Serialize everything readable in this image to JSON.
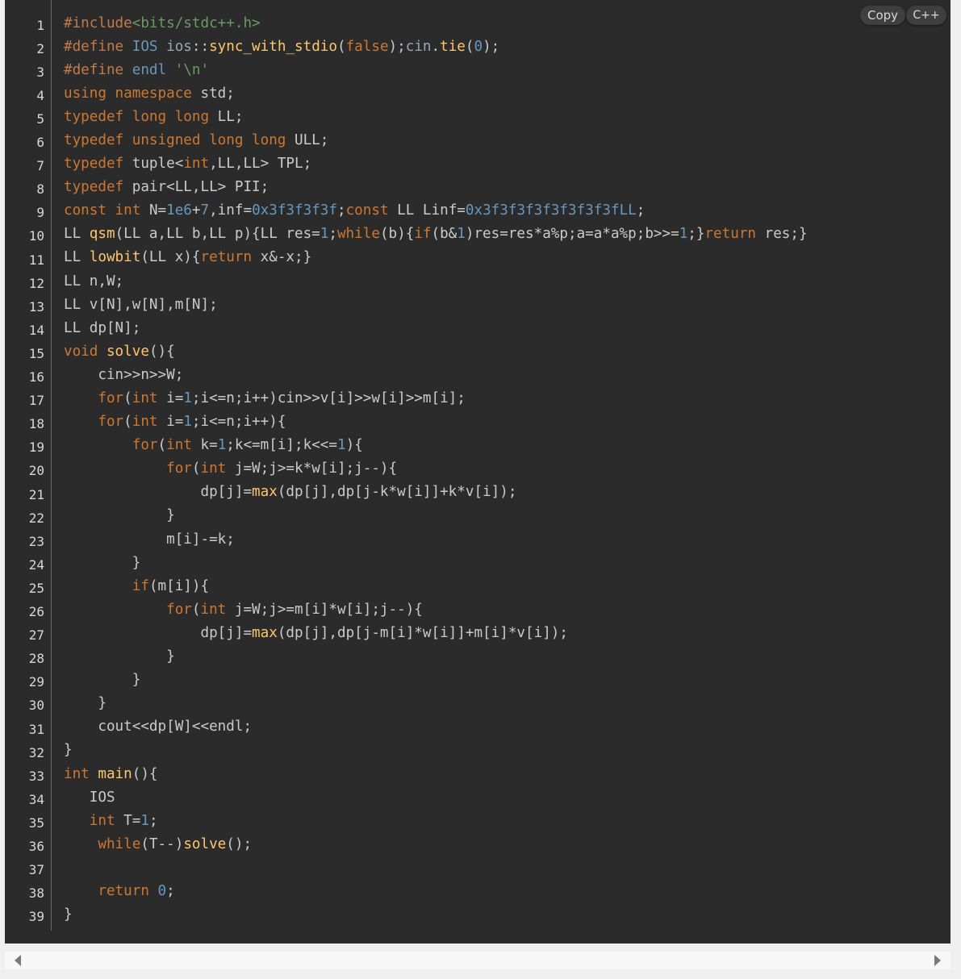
{
  "toolbar": {
    "copy_label": "Copy",
    "language": "C++"
  },
  "colors": {
    "background": "#2b2b2b",
    "preprocessor": "#c27a4b",
    "string": "#6b9a66",
    "keyword": "#cc7832",
    "function": "#ffc66d",
    "number": "#6897bb",
    "plain": "#c9cbcb",
    "line_number": "#d8d8d8"
  },
  "code": {
    "line_numbers": [
      "1",
      "2",
      "3",
      "4",
      "5",
      "6",
      "7",
      "8",
      "9",
      "10",
      "11",
      "12",
      "13",
      "14",
      "15",
      "16",
      "17",
      "18",
      "19",
      "20",
      "21",
      "22",
      "23",
      "24",
      "25",
      "26",
      "27",
      "28",
      "29",
      "30",
      "31",
      "32",
      "33",
      "34",
      "35",
      "36",
      "37",
      "38",
      "39"
    ],
    "lines": [
      [
        [
          "pp",
          "#include"
        ],
        [
          "str",
          "<bits/stdc++.h>"
        ]
      ],
      [
        [
          "pp",
          "#define "
        ],
        [
          "num",
          "IOS "
        ],
        [
          "lit",
          "ios"
        ],
        [
          "pl",
          "::"
        ],
        [
          "fn",
          "sync_with_stdio"
        ],
        [
          "pl",
          "("
        ],
        [
          "kw",
          "false"
        ],
        [
          "pl",
          ");"
        ],
        [
          "lit",
          "cin"
        ],
        [
          "pl",
          "."
        ],
        [
          "fn",
          "tie"
        ],
        [
          "pl",
          "("
        ],
        [
          "num",
          "0"
        ],
        [
          "pl",
          ");"
        ]
      ],
      [
        [
          "pp",
          "#define "
        ],
        [
          "num",
          "endl "
        ],
        [
          "str",
          "'\\n'"
        ]
      ],
      [
        [
          "kw",
          "using namespace "
        ],
        [
          "pl",
          "std;"
        ]
      ],
      [
        [
          "kw",
          "typedef long long "
        ],
        [
          "pl",
          "LL;"
        ]
      ],
      [
        [
          "kw",
          "typedef unsigned long long "
        ],
        [
          "pl",
          "ULL;"
        ]
      ],
      [
        [
          "kw",
          "typedef "
        ],
        [
          "pl",
          "tuple<"
        ],
        [
          "kw",
          "int"
        ],
        [
          "pl",
          ",LL,LL> TPL;"
        ]
      ],
      [
        [
          "kw",
          "typedef "
        ],
        [
          "pl",
          "pair<LL,LL> PII;"
        ]
      ],
      [
        [
          "kw",
          "const int "
        ],
        [
          "pl",
          "N="
        ],
        [
          "num",
          "1e6"
        ],
        [
          "pl",
          "+"
        ],
        [
          "num",
          "7"
        ],
        [
          "pl",
          ",inf="
        ],
        [
          "num",
          "0x3f3f3f3f"
        ],
        [
          "pl",
          ";"
        ],
        [
          "kw",
          "const "
        ],
        [
          "pl",
          "LL Linf="
        ],
        [
          "num",
          "0x3f3f3f3f3f3f3f3fLL"
        ],
        [
          "pl",
          ";"
        ]
      ],
      [
        [
          "pl",
          "LL "
        ],
        [
          "fn",
          "qsm"
        ],
        [
          "pl",
          "(LL a,LL b,LL p){LL res="
        ],
        [
          "num",
          "1"
        ],
        [
          "pl",
          ";"
        ],
        [
          "kw",
          "while"
        ],
        [
          "pl",
          "(b){"
        ],
        [
          "kw",
          "if"
        ],
        [
          "pl",
          "(b&"
        ],
        [
          "num",
          "1"
        ],
        [
          "pl",
          ")res=res*a%p;a=a*a%p;b>>="
        ],
        [
          "num",
          "1"
        ],
        [
          "pl",
          ";}"
        ],
        [
          "kw",
          "return "
        ],
        [
          "pl",
          "res;}"
        ]
      ],
      [
        [
          "pl",
          "LL "
        ],
        [
          "fn",
          "lowbit"
        ],
        [
          "pl",
          "(LL x){"
        ],
        [
          "kw",
          "return "
        ],
        [
          "pl",
          "x&-x;}"
        ]
      ],
      [
        [
          "pl",
          "LL n,W;"
        ]
      ],
      [
        [
          "pl",
          "LL v[N],w[N],m[N];"
        ]
      ],
      [
        [
          "pl",
          "LL dp[N];"
        ]
      ],
      [
        [
          "kw",
          "void "
        ],
        [
          "fn",
          "solve"
        ],
        [
          "pl",
          "(){"
        ]
      ],
      [
        [
          "pl",
          "    cin>>n>>W;"
        ]
      ],
      [
        [
          "pl",
          "    "
        ],
        [
          "kw",
          "for"
        ],
        [
          "pl",
          "("
        ],
        [
          "kw",
          "int "
        ],
        [
          "pl",
          "i="
        ],
        [
          "num",
          "1"
        ],
        [
          "pl",
          ";i<=n;i++)cin>>v[i]>>w[i]>>m[i];"
        ]
      ],
      [
        [
          "pl",
          "    "
        ],
        [
          "kw",
          "for"
        ],
        [
          "pl",
          "("
        ],
        [
          "kw",
          "int "
        ],
        [
          "pl",
          "i="
        ],
        [
          "num",
          "1"
        ],
        [
          "pl",
          ";i<=n;i++){"
        ]
      ],
      [
        [
          "pl",
          "        "
        ],
        [
          "kw",
          "for"
        ],
        [
          "pl",
          "("
        ],
        [
          "kw",
          "int "
        ],
        [
          "pl",
          "k="
        ],
        [
          "num",
          "1"
        ],
        [
          "pl",
          ";k<=m[i];k<<="
        ],
        [
          "num",
          "1"
        ],
        [
          "pl",
          "){"
        ]
      ],
      [
        [
          "pl",
          "            "
        ],
        [
          "kw",
          "for"
        ],
        [
          "pl",
          "("
        ],
        [
          "kw",
          "int "
        ],
        [
          "pl",
          "j=W;j>=k*w[i];j--){"
        ]
      ],
      [
        [
          "pl",
          "                dp[j]="
        ],
        [
          "fn",
          "max"
        ],
        [
          "pl",
          "(dp[j],dp[j-k*w[i]]+k*v[i]);"
        ]
      ],
      [
        [
          "pl",
          "            }"
        ]
      ],
      [
        [
          "pl",
          "            m[i]-=k;"
        ]
      ],
      [
        [
          "pl",
          "        }"
        ]
      ],
      [
        [
          "pl",
          "        "
        ],
        [
          "kw",
          "if"
        ],
        [
          "pl",
          "(m[i]){"
        ]
      ],
      [
        [
          "pl",
          "            "
        ],
        [
          "kw",
          "for"
        ],
        [
          "pl",
          "("
        ],
        [
          "kw",
          "int "
        ],
        [
          "pl",
          "j=W;j>=m[i]*w[i];j--){"
        ]
      ],
      [
        [
          "pl",
          "                dp[j]="
        ],
        [
          "fn",
          "max"
        ],
        [
          "pl",
          "(dp[j],dp[j-m[i]*w[i]]+m[i]*v[i]);"
        ]
      ],
      [
        [
          "pl",
          "            }"
        ]
      ],
      [
        [
          "pl",
          "        }"
        ]
      ],
      [
        [
          "pl",
          "    }"
        ]
      ],
      [
        [
          "pl",
          "    cout<<dp[W]<<endl;"
        ]
      ],
      [
        [
          "pl",
          "}"
        ]
      ],
      [
        [
          "kw",
          "int "
        ],
        [
          "fn",
          "main"
        ],
        [
          "pl",
          "(){"
        ]
      ],
      [
        [
          "pl",
          "   IOS"
        ]
      ],
      [
        [
          "pl",
          "   "
        ],
        [
          "kw",
          "int "
        ],
        [
          "pl",
          "T="
        ],
        [
          "num",
          "1"
        ],
        [
          "pl",
          ";"
        ]
      ],
      [
        [
          "pl",
          "    "
        ],
        [
          "kw",
          "while"
        ],
        [
          "pl",
          "(T--)"
        ],
        [
          "fn",
          "solve"
        ],
        [
          "pl",
          "();"
        ]
      ],
      [
        [
          "pl",
          ""
        ]
      ],
      [
        [
          "pl",
          "    "
        ],
        [
          "kw",
          "return "
        ],
        [
          "num",
          "0"
        ],
        [
          "pl",
          ";"
        ]
      ],
      [
        [
          "pl",
          "}"
        ]
      ]
    ]
  }
}
